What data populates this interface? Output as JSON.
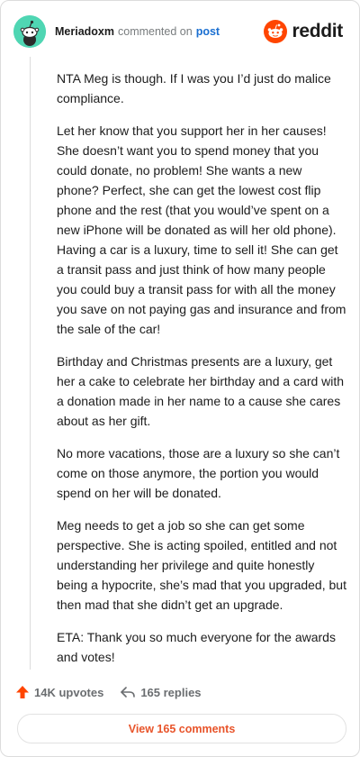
{
  "comment": {
    "username": "Meriadoxm",
    "action": "commented on",
    "post_link": "post",
    "paragraphs": [
      "NTA Meg is though. If I was you I’d just do malice compliance.",
      "Let her know that you support her in her causes! She doesn’t want you to spend money that you could donate, no problem! She wants a new phone? Perfect, she can get the lowest cost flip phone and the rest (that you would’ve spent on a new iPhone will be donated as will her old phone). Having a car is a luxury, time to sell it! She can get a transit pass and just think of how many people you could buy a transit pass for with all the money you save on not paying gas and insurance and from the sale of the car!",
      "Birthday and Christmas presents are a luxury, get her a cake to celebrate her birthday and a card with a donation made in her name to a cause she cares about as her gift.",
      "No more vacations, those are a luxury so she can’t come on those anymore, the portion you would spend on her will be donated.",
      "Meg needs to get a job so she can get some perspective. She is acting spoiled, entitled and not understanding her privilege and quite honestly being a hypocrite, she’s mad that you upgraded, but then mad that she didn’t get an upgrade.",
      "ETA: Thank you so much everyone for the awards and votes!"
    ]
  },
  "brand": {
    "name": "reddit",
    "color": "#ff4500"
  },
  "stats": {
    "upvotes": "14K upvotes",
    "replies": "165 replies"
  },
  "view_comments_label": "View 165 comments",
  "colors": {
    "link": "#1a6fd1",
    "accent": "#e8542a",
    "avatar": "#4fd6b3"
  },
  "icons": [
    "snoo-avatar-icon",
    "reddit-logo-icon",
    "upvote-arrow-icon",
    "reply-arrow-icon"
  ]
}
